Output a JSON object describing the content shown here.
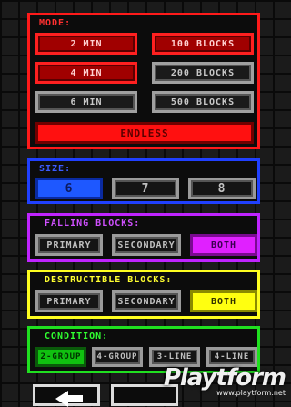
{
  "mode": {
    "title": "MODE:",
    "time_options": [
      "2 MIN",
      "4 MIN",
      "6 MIN"
    ],
    "block_options": [
      "100 BLOCKS",
      "200 BLOCKS",
      "500 BLOCKS"
    ],
    "endless": "ENDLESS",
    "selected_time": "2 MIN",
    "selected_blocks": "100 BLOCKS"
  },
  "size": {
    "title": "SIZE:",
    "options": [
      "6",
      "7",
      "8"
    ],
    "selected": "6"
  },
  "falling": {
    "title": "FALLING BLOCKS:",
    "options": [
      "PRIMARY",
      "SECONDARY",
      "BOTH"
    ],
    "selected": "BOTH"
  },
  "destructible": {
    "title": "DESTRUCTIBLE BLOCKS:",
    "options": [
      "PRIMARY",
      "SECONDARY",
      "BOTH"
    ],
    "selected": "BOTH"
  },
  "condition": {
    "title": "CONDITION:",
    "options": [
      "2-GROUP",
      "4-GROUP",
      "3-LINE",
      "4-LINE"
    ],
    "selected": "2-GROUP"
  },
  "nav": {
    "back_icon": "left-arrow-icon"
  },
  "watermark": {
    "logo": "Playtform",
    "url": "www.playtform.net"
  },
  "colors": {
    "mode": "#ff1a1a",
    "size": "#2040ff",
    "falling": "#c024ff",
    "destructible": "#ffff20",
    "condition": "#20e020"
  }
}
